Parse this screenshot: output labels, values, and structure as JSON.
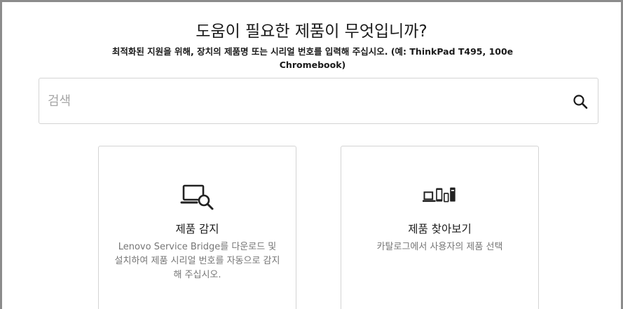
{
  "heading": "도움이 필요한 제품이 무엇입니까?",
  "subtitle": "최적화된 지원을 위해, 장치의 제품명 또는 시리얼 번호를 입력해 주십시오. (예: ThinkPad T495, 100e Chromebook)",
  "search": {
    "placeholder": "검색",
    "value": "",
    "icon": "search-icon"
  },
  "cards": {
    "detect": {
      "icon": "laptop-magnifier-icon",
      "title": "제품 감지",
      "description": "Lenovo Service Bridge를 다운로드 및 설치하여 제품 시리얼 번호를 자동으로 감지해 주십시오."
    },
    "browse": {
      "icon": "devices-icon",
      "title": "제품 찾아보기",
      "description": "카탈로그에서 사용자의 제품 선택"
    }
  },
  "colors": {
    "border": "#8c8c8c",
    "card_border": "#d4d4d4",
    "text": "#1a1a1a",
    "muted_text": "#767676",
    "placeholder": "#a6a6a6"
  }
}
